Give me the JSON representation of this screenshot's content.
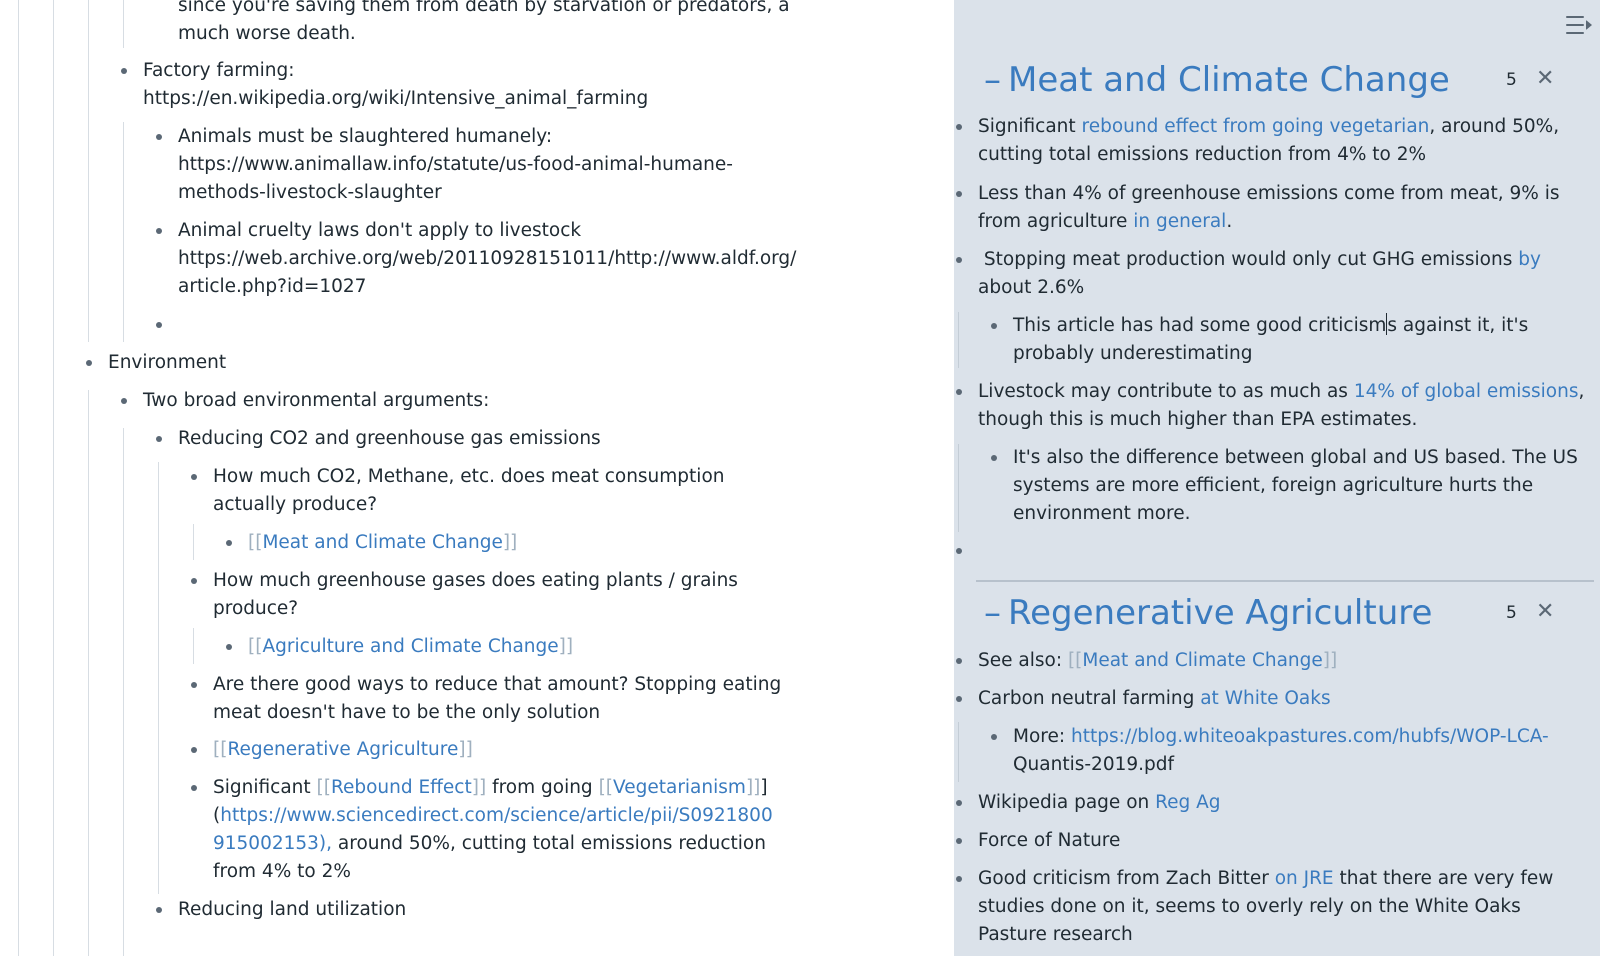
{
  "main": {
    "blocks": [
      {
        "id": "b1a",
        "text": "since you're saving them from death by starvation or predators, a"
      },
      {
        "id": "b1b",
        "text": "much worse death."
      },
      {
        "id": "b2a",
        "text": "Factory farming:"
      },
      {
        "id": "b2b",
        "link": "https://en.wikipedia.org/wiki/Intensive_animal_farming"
      },
      {
        "id": "b3a",
        "text": "Animals must be slaughtered humanely:"
      },
      {
        "id": "b3b",
        "link": "https://www.animallaw.info/statute/us-food-animal-humane-"
      },
      {
        "id": "b3c",
        "link": "methods-livestock-slaughter"
      },
      {
        "id": "b4a",
        "text": "Animal cruelty laws don't apply to livestock"
      },
      {
        "id": "b4b",
        "link": "https://web.archive.org/web/20110928151011/http://www.aldf.org/"
      },
      {
        "id": "b4c",
        "link": "article.php?id=1027"
      },
      {
        "id": "b6",
        "text": "Environment"
      },
      {
        "id": "b7",
        "text": "Two broad environmental arguments:"
      },
      {
        "id": "b8",
        "text": "Reducing CO2 and greenhouse gas emissions"
      },
      {
        "id": "b9a",
        "text": "How much CO2, Methane, etc. does meat consumption"
      },
      {
        "id": "b9b",
        "text": "actually produce?"
      },
      {
        "id": "b10",
        "ref": "Meat and Climate Change"
      },
      {
        "id": "b11a",
        "text": "How much greenhouse gases does eating plants / grains"
      },
      {
        "id": "b11b",
        "text": "produce?"
      },
      {
        "id": "b12",
        "ref": "Agriculture and Climate Change"
      },
      {
        "id": "b13a",
        "text": "Are there good ways to reduce that amount? Stopping eating"
      },
      {
        "id": "b13b",
        "text": "meat doesn't have to be the only solution"
      },
      {
        "id": "b14",
        "ref": "Regenerative Agriculture"
      },
      {
        "id": "b15",
        "pre": "Significant ",
        "ref1": "Rebound Effect",
        "mid": " from going ",
        "ref2": "Vegetarianism",
        "post": "]"
      },
      {
        "id": "b15b",
        "pre": "(",
        "link": "https://www.sciencedirect.com/science/article/pii/S0921800"
      },
      {
        "id": "b15c",
        "link": "915002153),",
        "post": " around 50%, cutting total emissions reduction"
      },
      {
        "id": "b15d",
        "text": "from 4% to 2%"
      },
      {
        "id": "b16",
        "text": "Reducing land utilization"
      }
    ]
  },
  "sidebar": {
    "page1": {
      "title": "Meat and Climate Change",
      "count": "5",
      "items": {
        "i1a_pre": "Significant ",
        "i1a_link": "rebound effect from going vegetarian",
        "i1a_post": ", around 50%,",
        "i1b": "cutting total emissions reduction from 4% to 2%",
        "i2a": "Less than 4% of greenhouse emissions come from meat, 9% is",
        "i2b_pre": "from agriculture ",
        "i2b_link": "in general",
        "i2b_post": ".",
        "i3a_pre": " Stopping meat production would only cut GHG emissions ",
        "i3a_link": "by",
        "i3b_link": "about 2.6%",
        "i4a_pre": "This article has had some good criticism",
        "i4a_post": "s against it, it's",
        "i4b": "probably underestimating",
        "i5a_pre": "Livestock may contribute to as much as ",
        "i5a_link": "14% of global emissions",
        "i5a_post": ",",
        "i5b": "though this is much higher than EPA estimates.",
        "i6a": "It's also the difference between global and US based. The US",
        "i6b": "systems are more efficient, foreign agriculture hurts the",
        "i6c": "environment more."
      }
    },
    "page2": {
      "title": "Regenerative Agriculture",
      "count": "5",
      "items": {
        "j1_pre": "See also: ",
        "j1_ref": "Meat and Climate Change",
        "j2_pre": "Carbon neutral farming ",
        "j2_link": "at White Oaks",
        "j3a_pre": "More: ",
        "j3a_link": "https://blog.whiteoakpastures.com/hubfs/WOP-LCA-",
        "j3b_link": "Quantis-2019.pdf",
        "j4_pre": "Wikipedia page on ",
        "j4_link": "Reg Ag",
        "j5": "Force of Nature",
        "j6a_pre": "Good criticism from Zach Bitter ",
        "j6a_link": "on JRE",
        "j6a_post": " that there are very few",
        "j6b": "studies done on it, seems to overly rely on the White Oaks",
        "j6c": "Pasture research"
      }
    },
    "dash": "–",
    "close": "✕"
  },
  "brackets": {
    "open": "[[",
    "close": "]]"
  }
}
